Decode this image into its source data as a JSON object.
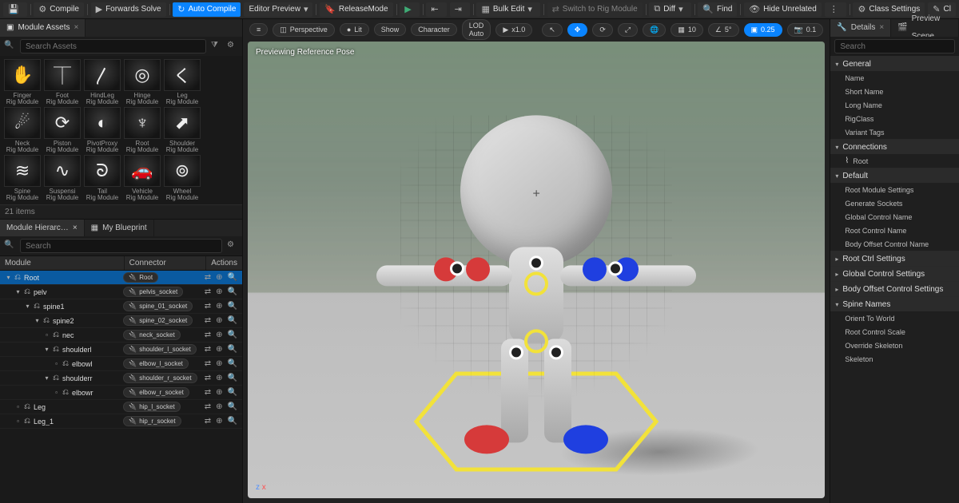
{
  "toolbar": {
    "disk_icon": "floppy-dison",
    "compile": "Compile",
    "forwardsSolve": "Forwards Solve",
    "autoCompile": "Auto Compile",
    "editorPreview": "Editor Preview",
    "releaseMode": "ReleaseMode",
    "bulkEdit": "Bulk Edit",
    "switchToRig": "Switch to Rig Module",
    "diff": "Diff",
    "find": "Find",
    "hideUnrelated": "Hide Unrelated",
    "classSettings": "Class Settings",
    "cl": "Cl"
  },
  "moduleAssets": {
    "tabLabel": "Module Assets",
    "searchPlaceholder": "Search Assets",
    "itemsCount": "21 items",
    "items": [
      {
        "label": "Finger",
        "sub": "Rig Module",
        "glyph": "✋"
      },
      {
        "label": "Foot",
        "sub": "Rig Module",
        "glyph": "⏉"
      },
      {
        "label": "HindLeg",
        "sub": "Rig Module",
        "glyph": "〳"
      },
      {
        "label": "Hinge",
        "sub": "Rig Module",
        "glyph": "◎"
      },
      {
        "label": "Leg",
        "sub": "Rig Module",
        "glyph": "く"
      },
      {
        "label": "Neck",
        "sub": "Rig Module",
        "glyph": "☄"
      },
      {
        "label": "Piston",
        "sub": "Rig Module",
        "glyph": "⟳"
      },
      {
        "label": "PivotProxy",
        "sub": "Rig Module",
        "glyph": "◐"
      },
      {
        "label": "Root",
        "sub": "Rig Module",
        "glyph": "♆"
      },
      {
        "label": "Shoulder",
        "sub": "Rig Module",
        "glyph": "⬈"
      },
      {
        "label": "Spine",
        "sub": "Rig Module",
        "glyph": "≋"
      },
      {
        "label": "Suspensi",
        "sub": "Rig Module",
        "glyph": "∿"
      },
      {
        "label": "Tail",
        "sub": "Rig Module",
        "glyph": "ᘐ"
      },
      {
        "label": "Vehicle",
        "sub": "Rig Module",
        "glyph": "🚗"
      },
      {
        "label": "Wheel",
        "sub": "Rig Module",
        "glyph": "⊚"
      }
    ]
  },
  "hierarchyTabs": {
    "tab1": "Module Hierarc…",
    "tab2": "My Blueprint",
    "searchPlaceholder": "Search"
  },
  "moduleTable": {
    "headers": {
      "module": "Module",
      "connector": "Connector",
      "actions": "Actions"
    },
    "rows": [
      {
        "indent": 0,
        "name": "Root",
        "connector": "Root",
        "selected": true,
        "twisty": "▾",
        "icon": "⌂"
      },
      {
        "indent": 1,
        "name": "pelv",
        "connector": "pelvis_socket",
        "twisty": "▾"
      },
      {
        "indent": 2,
        "name": "spine1",
        "connector": "spine_01_socket",
        "twisty": "▾"
      },
      {
        "indent": 3,
        "name": "spine2",
        "connector": "spine_02_socket",
        "twisty": "▾"
      },
      {
        "indent": 4,
        "name": "nec",
        "connector": "neck_socket",
        "twisty": "▫"
      },
      {
        "indent": 4,
        "name": "shoulderl",
        "connector": "shoulder_l_socket",
        "twisty": "▾"
      },
      {
        "indent": 5,
        "name": "elbowl",
        "connector": "elbow_l_socket",
        "twisty": "▫"
      },
      {
        "indent": 4,
        "name": "shoulderr",
        "connector": "shoulder_r_socket",
        "twisty": "▾"
      },
      {
        "indent": 5,
        "name": "elbowr",
        "connector": "elbow_r_socket",
        "twisty": "▫"
      },
      {
        "indent": 1,
        "name": "Leg",
        "connector": "hip_l_socket",
        "twisty": "▫"
      },
      {
        "indent": 1,
        "name": "Leg_1",
        "connector": "hip_r_socket",
        "twisty": "▫"
      }
    ]
  },
  "viewport": {
    "menu": "≡",
    "perspective": "Perspective",
    "lit": "Lit",
    "show": "Show",
    "character": "Character",
    "lod": "LOD Auto",
    "speed": "x1.0",
    "snapGrid": "10",
    "snapAngle": "5°",
    "snapScale": "0.25",
    "camSpeed": "0.1",
    "previewPose": "Previewing Reference Pose"
  },
  "details": {
    "detailsTab": "Details",
    "previewTab": "Preview Scene…",
    "searchPlaceholder": "Search",
    "groups": [
      {
        "title": "General",
        "items": [
          "Name",
          "Short Name",
          "Long Name",
          "RigClass",
          "Variant Tags"
        ]
      },
      {
        "title": "Connections",
        "items": [
          {
            "label": "Root",
            "icon": "bone"
          }
        ]
      },
      {
        "title": "Default",
        "items": [
          "Root Module Settings",
          "Generate Sockets",
          "Global Control Name",
          "Root Control Name",
          "Body Offset Control Name"
        ]
      },
      {
        "title": "Root Ctrl Settings",
        "collapsed": true
      },
      {
        "title": "Global Control Settings",
        "collapsed": true
      },
      {
        "title": "Body Offset Control Settings",
        "collapsed": true
      },
      {
        "title": "Spine Names",
        "items": [
          "Orient To World",
          "Root Control Scale",
          "Override Skeleton",
          "Skeleton"
        ]
      }
    ]
  }
}
